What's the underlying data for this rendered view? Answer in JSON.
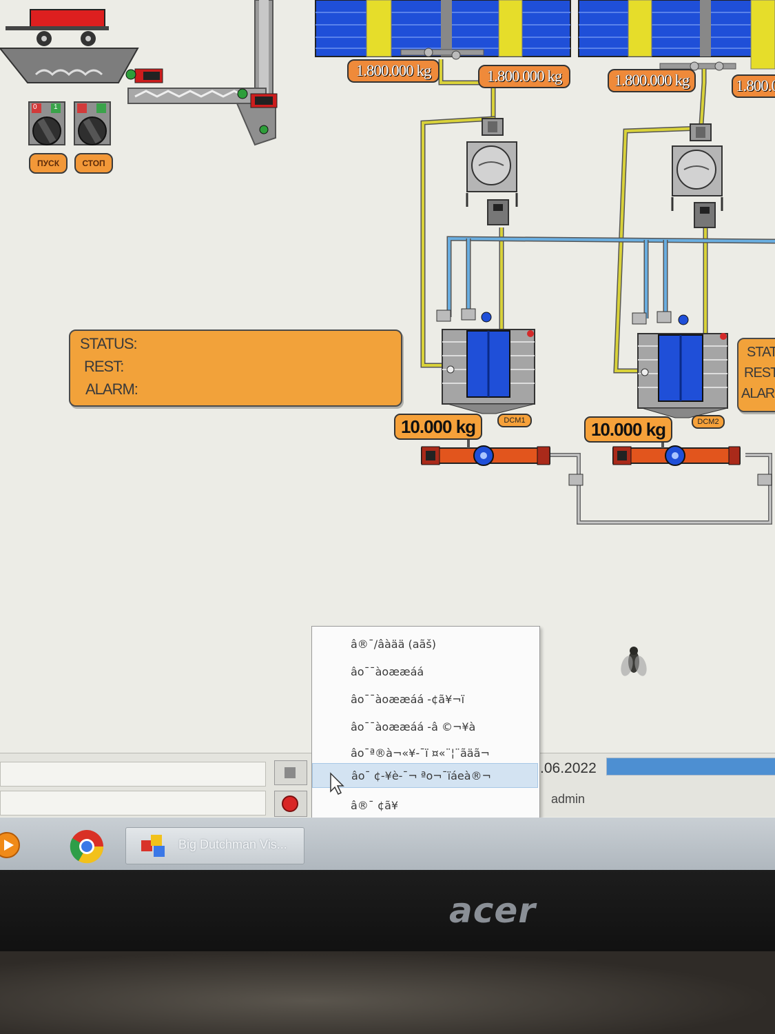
{
  "silos": {
    "weights": [
      "1.800.000 kg",
      "1.800.000 kg",
      "1.800.000 kg",
      "1.800.0"
    ]
  },
  "feeder": {
    "buttons": [
      {
        "label": "ПУСК"
      },
      {
        "label": "СТОП"
      }
    ],
    "switch_marks": [
      "0",
      "1"
    ]
  },
  "status_panel": {
    "status_label": "STATUS:",
    "rest_label": "REST:",
    "alarm_label": "ALARM:"
  },
  "status_panel_right": {
    "status_label": "STAT",
    "rest_label": "REST",
    "alarm_label": "ALAR"
  },
  "dosing": [
    {
      "weight": "10.000 kg",
      "tag": "DCM1"
    },
    {
      "weight": "10.000 kg",
      "tag": "DCM2"
    }
  ],
  "context_menu": {
    "items": [
      "â®¯/âàää (aãš)",
      "âo¯¯àoææáá",
      "âo¯¯àoææáá -¢ã¥¬ï",
      "âo¯¯àoææáá -â ©¬¥à",
      "âo¯ª®à¬«¥-¯ï ¤«¨¦¨ãäã¬",
      "âo¯ ¢-¥è-¯¬ ªo¬¯ïáeà®¬",
      "â®¯ ¢ã¥"
    ],
    "highlighted_index": 5
  },
  "statusbar": {
    "date": ".06.2022",
    "user": "admin",
    "progress": 1.0
  },
  "taskbar": {
    "app_title": "Big Dutchman Vis..."
  },
  "monitor": {
    "brand": "acer"
  },
  "colors": {
    "screen_bg": "#ecece6",
    "accent_orange": "#f2a23a",
    "silo_blue": "#1f4fd8",
    "silo_yellow": "#e6dd2a",
    "pipe_yellow": "#d9d23a",
    "pipe_blue": "#6aaee0",
    "auger_orange": "#e2551d",
    "menu_highlight": "#d3e3f2"
  }
}
